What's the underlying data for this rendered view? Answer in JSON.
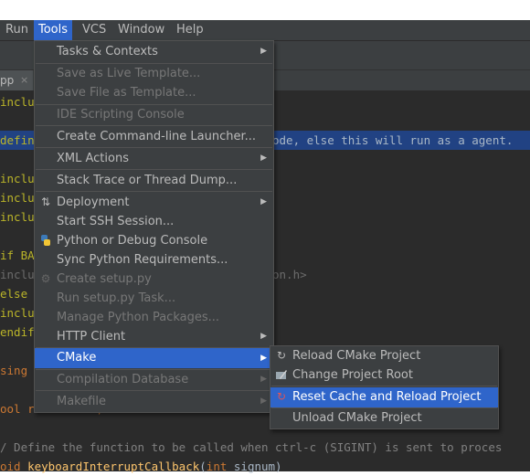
{
  "menubar": {
    "items": [
      {
        "label": "Run"
      },
      {
        "label": "Tools",
        "active": true
      },
      {
        "label": "VCS"
      },
      {
        "label": "Window"
      },
      {
        "label": "Help"
      }
    ]
  },
  "tab": {
    "label": "pp",
    "close_glyph": "×"
  },
  "editor": {
    "lines": [
      {
        "t1": "inclu",
        "t2": ""
      },
      {
        "t1": "define",
        "t2": "ode, else this will run as a agent."
      },
      {
        "t1": "inclu",
        "t2": ""
      },
      {
        "t1": "inclu",
        "t2": ""
      },
      {
        "t1": "inclu",
        "t2": ""
      },
      {
        "t1": "if BA",
        "t2": ""
      },
      {
        "t1": "inclu",
        "t2": "on.h>"
      },
      {
        "t1": "else",
        "t2": ""
      },
      {
        "t1": "inclu",
        "t2": ""
      },
      {
        "t1": "endif",
        "t2": ""
      },
      {
        "t1": "sing",
        "t2": ""
      },
      {
        "t1": "ool run = true;",
        "t2": ""
      },
      {
        "t1": "/ Define the function to be called when ctrl-c (SIGINT) is sent to proces",
        "t2": ""
      },
      {
        "t1": "oid ",
        "t2": "keyboardInterruptCallback",
        "t3": "(",
        "t4": "int",
        "t5": " signum)"
      }
    ]
  },
  "tools_menu": {
    "items": [
      {
        "label": "Tasks & Contexts",
        "submenu": true
      },
      {
        "label": "Save as Live Template...",
        "disabled": true
      },
      {
        "label": "Save File as Template...",
        "disabled": true
      },
      {
        "label": "IDE Scripting Console",
        "disabled": true
      },
      {
        "label": "Create Command-line Launcher..."
      },
      {
        "label": "XML Actions",
        "submenu": true
      },
      {
        "label": "Stack Trace or Thread Dump..."
      },
      {
        "label": "Deployment",
        "submenu": true,
        "icon": "deployment-icon"
      },
      {
        "label": "Start SSH Session..."
      },
      {
        "label": "Python or Debug Console",
        "icon": "python-icon"
      },
      {
        "label": "Sync Python Requirements..."
      },
      {
        "label": "Create setup.py",
        "disabled": true,
        "icon": "setup-py-icon"
      },
      {
        "label": "Run setup.py Task...",
        "disabled": true
      },
      {
        "label": "Manage Python Packages...",
        "disabled": true
      },
      {
        "label": "HTTP Client",
        "submenu": true
      },
      {
        "label": "CMake",
        "submenu": true,
        "selected": true
      },
      {
        "label": "Compilation Database",
        "submenu": true,
        "disabled": true
      },
      {
        "label": "Makefile",
        "submenu": true,
        "disabled": true
      }
    ]
  },
  "cmake_menu": {
    "items": [
      {
        "label": "Reload CMake Project",
        "icon": "reload-icon"
      },
      {
        "label": "Change Project Root",
        "icon": "change-root-icon"
      },
      {
        "label": "Reset Cache and Reload Project",
        "icon": "reset-cache-icon",
        "selected": true
      },
      {
        "label": "Unload CMake Project"
      }
    ]
  },
  "colors": {
    "menu_bg": "#3c3f41",
    "selection": "#2f65ca",
    "editor_bg": "#2b2b2b",
    "disabled_text": "#777777"
  }
}
